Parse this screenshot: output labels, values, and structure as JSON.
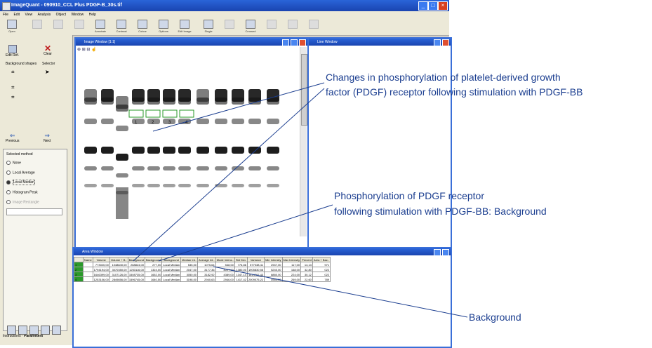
{
  "window": {
    "title": "ImageQuant - 090910_CCL Plus PDGF-B_30s.tif"
  },
  "menu": [
    "File",
    "Edit",
    "View",
    "Analysis",
    "Object",
    "Window",
    "Help"
  ],
  "toolbar": [
    "Open",
    "",
    "",
    "",
    "Annotate",
    "Contrast",
    "Colour",
    "Options",
    "Edit Image",
    "Single",
    "",
    "Crossed",
    "",
    "",
    ""
  ],
  "left_panel": {
    "buttons": [
      "Edit Ref.",
      "Clear"
    ],
    "section_labels": [
      "Background shapes",
      "Selector"
    ],
    "nav": [
      "Previous",
      "Next"
    ],
    "method_title": "Selected method",
    "methods": [
      "None",
      "Local Average",
      "Local Median",
      "Histogram Peak",
      "Image Rectangle"
    ],
    "tabs": [
      "Instructions",
      "Parameters"
    ]
  },
  "image_window": {
    "title": "Image Window [1:1]",
    "toolbar": "⊕ ⊞ ⊟ ☝",
    "lane_markers": [
      "1",
      "2",
      "3",
      "4"
    ]
  },
  "line_window": {
    "title": "Line Window"
  },
  "area_window": {
    "title": "Area Window",
    "columns": [
      "",
      "Name",
      "Volume",
      "Volume + B..",
      "Background",
      "Background",
      "Background",
      "Median Int..",
      "Average Int..",
      "Mode Intens..",
      "Std Dev.",
      "Variance",
      "Min Intensity",
      "Max Intensity",
      "Percent",
      "Area + Bac.."
    ],
    "rows": [
      [
        "1",
        "",
        "773020,00",
        "1048840,00",
        "268824,00",
        "277,00",
        "Local Median",
        "535,00",
        "1075,64",
        "548,00",
        "776,86",
        "577038,41",
        "2947,00",
        "117,00",
        "14,13",
        "971"
      ],
      [
        "2",
        "",
        "1794194,00",
        "3070350,00",
        "1253116,00",
        "1324,00",
        "Local Median",
        "2047,00",
        "3177,36",
        "4097,00",
        "1380,00",
        "1905830,56",
        "5240,00",
        "168,00",
        "32,80",
        "022"
      ],
      [
        "3",
        "",
        "1646399,00",
        "3107126,00",
        "1508735,00",
        "1652,00",
        "Local Median",
        "3050,00",
        "3182,92",
        "4389,00",
        "1347,14",
        "1814797,43",
        "8880,00",
        "224,00",
        "30,12",
        "022"
      ],
      [
        "4",
        "",
        "1253106,00",
        "2849856,00",
        "1596745,00",
        "1640,50",
        "Local Median",
        "3198,00",
        "2940,63",
        "2946,00",
        "1417,42",
        "2009075,22",
        "4960,00",
        "269,00",
        "22,60",
        "789"
      ]
    ]
  },
  "annotations": {
    "a1": [
      "Changes in phosphorylation of platelet-derived growth",
      "factor (PDGF) receptor following stimulation with PDGF-BB"
    ],
    "a2": [
      "Phosphorylation of PDGF receptor",
      "following stimulation with PDGF-BB: Background"
    ],
    "a3": "Background"
  },
  "colors": {
    "annotation": "#1a3d8f",
    "window_title": "#2a64d8",
    "row_marker": "#2a9a2a"
  }
}
